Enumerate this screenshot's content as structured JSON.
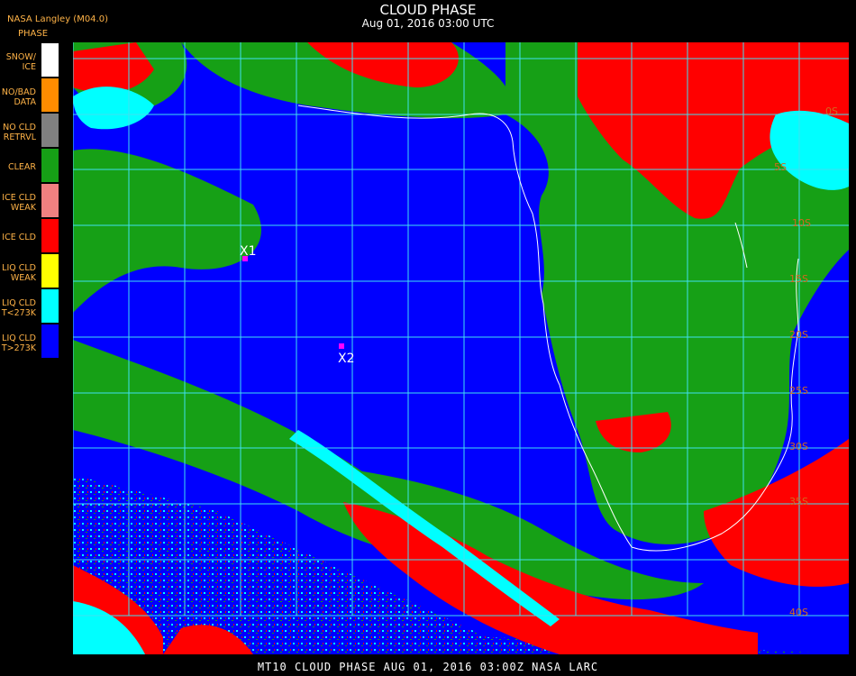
{
  "header": {
    "source": "NASA Langley (M04.0)",
    "title": "CLOUD PHASE",
    "datetime": "Aug 01, 2016 03:00 UTC"
  },
  "legend": {
    "title": "PHASE",
    "items": [
      {
        "label": "SNOW/\nICE",
        "color": "#ffffff"
      },
      {
        "label": "NO/BAD\nDATA",
        "color": "#ff8c00"
      },
      {
        "label": "NO CLD\nRETRVL",
        "color": "#808080"
      },
      {
        "label": "CLEAR",
        "color": "#16a016"
      },
      {
        "label": "ICE CLD\nWEAK",
        "color": "#f08080"
      },
      {
        "label": "ICE CLD",
        "color": "#ff0000"
      },
      {
        "label": "LIQ CLD\nWEAK",
        "color": "#ffff00"
      },
      {
        "label": "LIQ CLD\nT<273K",
        "color": "#00ffff"
      },
      {
        "label": "LIQ CLD\nT>273K",
        "color": "#0000ff"
      }
    ]
  },
  "markers": [
    {
      "label": "X1"
    },
    {
      "label": "X2"
    }
  ],
  "lat_labels": [
    "0S",
    "5S",
    "10S",
    "15S",
    "20S",
    "25S",
    "30S",
    "35S",
    "40S"
  ],
  "colors": {
    "liquid_warm": "#0000ff",
    "liquid_cold": "#00ffff",
    "clear": "#16a016",
    "ice": "#ff0000",
    "grid": "#40e0f0",
    "coast": "#ffffff",
    "marker": "#ff00ff"
  },
  "footer": {
    "text": "MT10  CLOUD PHASE   AUG 01, 2016 03:00Z   NASA LARC"
  }
}
